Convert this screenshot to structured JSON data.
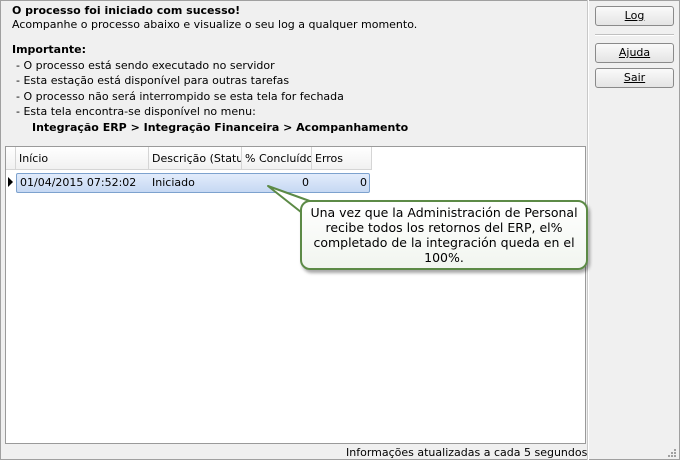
{
  "info": {
    "success_title": "O processo foi iniciado com sucesso!",
    "subtitle": "Acompanhe o processo abaixo e visualize o seu log a qualquer momento.",
    "important_heading": "Importante:",
    "bullets": [
      "- O processo está sendo executado no servidor",
      "- Esta estação está disponível para outras tarefas",
      "- O processo não será interrompido se esta tela for fechada",
      "- Esta tela encontra-se disponível no menu:"
    ],
    "menu_path": "Integração ERP > Integração Financeira > Acompanhamento"
  },
  "buttons": {
    "log": "Log",
    "help": "Ajuda",
    "exit": "Sair"
  },
  "grid": {
    "columns": [
      "Início",
      "Descrição (Status)",
      "% Concluído",
      "Erros"
    ],
    "rows": [
      {
        "inicio": "01/04/2015 07:52:02",
        "descricao": "Iniciado",
        "concluido": "0",
        "erros": "0"
      }
    ]
  },
  "status_bar": {
    "text": "Informações atualizadas a cada 5 segundos"
  },
  "callout": {
    "lines": [
      "Una vez que la Administración de Personal",
      "recibe todos los retornos del ERP, el%",
      "completado de la integración queda en el",
      "100%."
    ]
  },
  "colors": {
    "selection": "#c6d8f3",
    "callout_border": "#5c8a46"
  }
}
